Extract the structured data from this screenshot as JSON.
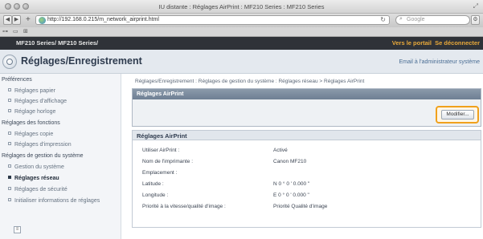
{
  "window": {
    "title": "IU distante : Réglages AirPrint : MF210 Series : MF210 Series"
  },
  "browser": {
    "url": "http://192.168.0.215/m_network_airprint.html",
    "search_placeholder": "Google",
    "back_icon": "back-arrow-icon",
    "forward_icon": "forward-arrow-icon"
  },
  "topbar": {
    "device_title": "MF210 Series/ MF210 Series/",
    "portal_link": "Vers le portail",
    "logout_link": "Se déconnecter"
  },
  "header": {
    "title": "Réglages/Enregistrement",
    "admin_link": "Email à l'administrateur système"
  },
  "sidebar": {
    "preferences_heading": "Préférences",
    "preferences_items": [
      "Réglages papier",
      "Réglages d'affichage",
      "Réglage horloge"
    ],
    "functions_heading": "Réglages des fonctions",
    "functions_items": [
      "Réglages copie",
      "Réglages d'impression"
    ],
    "system_heading": "Réglages de gestion du système",
    "system_items": [
      "Gestion du système",
      "Réglages réseau",
      "Réglages de sécurité",
      "Initialiser informations de réglages"
    ],
    "active_item": "Réglages réseau"
  },
  "main": {
    "breadcrumb": "Réglages/Enregistrement : Réglages de gestion du système : Réglages réseau > Réglages AirPrint",
    "panel_title": "Réglages AirPrint",
    "modify_button": "Modifier...",
    "details_title": "Réglages AirPrint",
    "rows": [
      {
        "label": "Utiliser AirPrint :",
        "value": "Activé"
      },
      {
        "label": "Nom de l'imprimante :",
        "value": "Canon MF210"
      },
      {
        "label": "Emplacement :",
        "value": ""
      },
      {
        "label": "Latitude :",
        "value": "N 0 ° 0 ' 0.000 \""
      },
      {
        "label": "Longitude :",
        "value": "E 0 ° 0 ' 0.000 \""
      },
      {
        "label": "Priorité à la vitesse/qualité d'image :",
        "value": "Priorité Qualité d'image"
      }
    ]
  },
  "colors": {
    "dark_bar": "#2f3238",
    "link_orange": "#e9a93a",
    "highlight_ring": "#f0a11c"
  }
}
